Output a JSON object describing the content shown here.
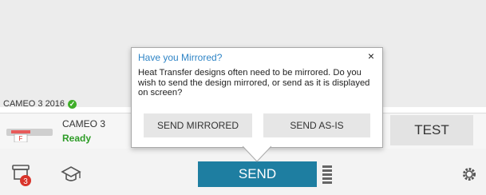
{
  "machine": {
    "status_label": "CAMEO 3 2016",
    "name": "CAMEO 3",
    "state": "Ready",
    "thumb_letter": "F"
  },
  "dialog": {
    "title": "Have you Mirrored?",
    "close_glyph": "×",
    "message": "Heat Transfer designs often need to be mirrored. Do you wish to send the design mirrored, or send as it is displayed on screen?",
    "send_mirrored_label": "SEND MIRRORED",
    "send_asis_label": "SEND AS-IS"
  },
  "actions": {
    "test_label": "TEST",
    "send_label": "SEND"
  },
  "bottom": {
    "library_badge": "3"
  },
  "colors": {
    "accent": "#1e7ea1",
    "ready": "#2e9c27",
    "dialog_title": "#2e84c6",
    "badge": "#d9342b"
  },
  "icons": [
    "check-icon",
    "close-icon",
    "library-icon",
    "graduation-cap-icon",
    "queue-icon",
    "gear-icon"
  ]
}
